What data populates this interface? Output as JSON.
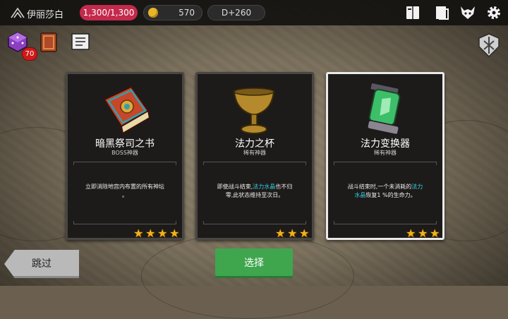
{
  "header": {
    "player_name": "伊丽莎白",
    "hp": "1,300/1,300",
    "gold": "570",
    "day": "D+260"
  },
  "quick_items": {
    "badge_count": "70"
  },
  "cards": [
    {
      "title": "暗黑祭司之书",
      "subtitle": "BOSS神器",
      "desc_line1": "立即消除地宫内布置的所有神坛",
      "desc_line2": "。",
      "stars": 4,
      "selected": false
    },
    {
      "title": "法力之杯",
      "subtitle": "稀有神器",
      "desc_pre": "即使战斗结束,",
      "desc_hl": "法力水晶",
      "desc_mid": "也不归",
      "desc_line2": "零,此状态维持至次日。",
      "stars": 3,
      "selected": false
    },
    {
      "title": "法力变换器",
      "subtitle": "稀有神器",
      "desc_pre": "战斗结束时,一个未消耗的",
      "desc_hl": "法力",
      "desc_hl2": "水晶",
      "desc_post": "恢复1 %的生命力。",
      "stars": 3,
      "selected": true
    }
  ],
  "buttons": {
    "skip": "跳过",
    "choose": "选择"
  },
  "colors": {
    "hp_pill": "#c42a4c",
    "highlight": "#34d0e6",
    "choose_button": "#3fa64e",
    "star": "#f3b21c"
  },
  "icons": [
    "menu-icon",
    "coin-icon",
    "journal-icon",
    "book-icon",
    "demon-icon",
    "gear-icon",
    "dice-icon",
    "spellbook-icon",
    "scroll-icon",
    "rank-emblem-icon",
    "star-icon"
  ]
}
